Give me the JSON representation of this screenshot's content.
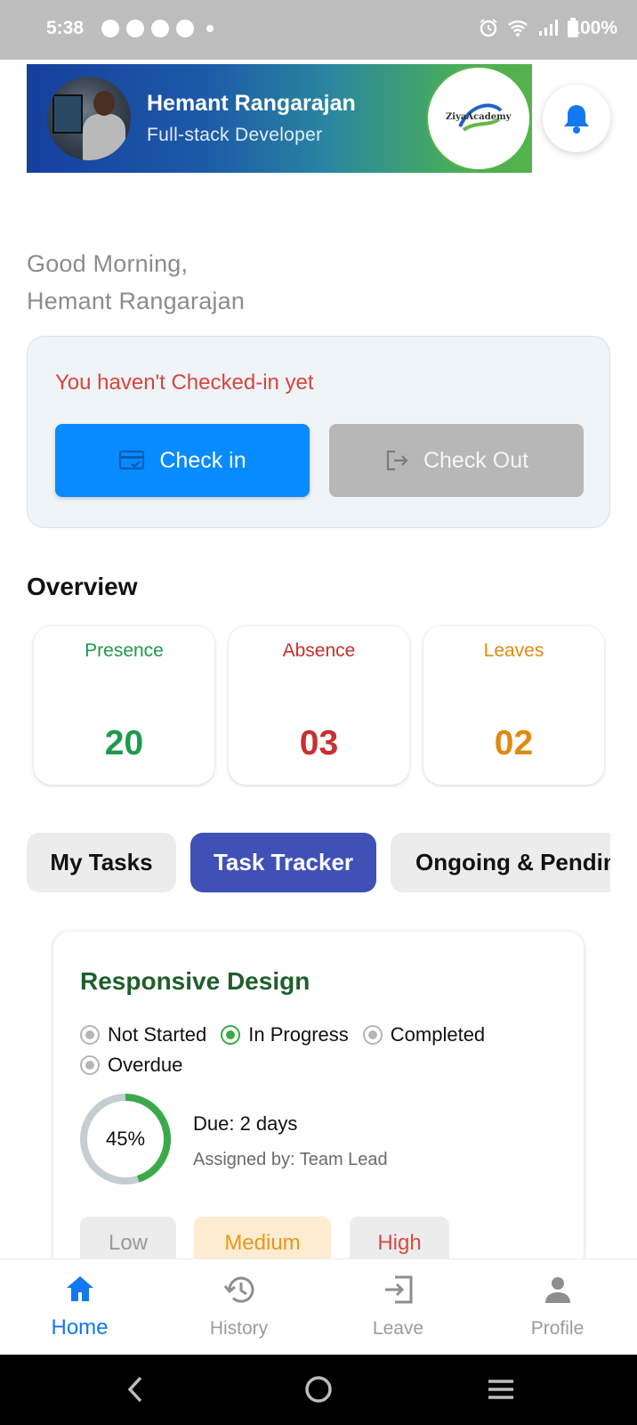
{
  "status_bar": {
    "time": "5:38",
    "battery": "100%",
    "notification_icons": [
      "chat-icon",
      "whatsapp-icon",
      "app-icon",
      "compass-icon",
      "dot-icon"
    ],
    "system_icons": [
      "alarm-icon",
      "wifi-icon",
      "signal-icon",
      "battery-icon"
    ]
  },
  "profile": {
    "name": "Hemant Rangarajan",
    "role": "Full-stack Developer",
    "logo_text": "ZiyaAcademy"
  },
  "greeting": {
    "line1": "Good Morning,",
    "line2": "Hemant Rangarajan"
  },
  "checkin": {
    "status_message": "You haven't Checked-in yet",
    "checkin_label": "Check in",
    "checkout_label": "Check Out"
  },
  "overview": {
    "title": "Overview",
    "stats": [
      {
        "label": "Presence",
        "value": "20",
        "color": "#1e9a4a"
      },
      {
        "label": "Absence",
        "value": "03",
        "color": "#c8302e"
      },
      {
        "label": "Leaves",
        "value": "02",
        "color": "#e08a12"
      }
    ]
  },
  "tabs": [
    {
      "label": "My Tasks",
      "active": false
    },
    {
      "label": "Task Tracker",
      "active": true
    },
    {
      "label": "Ongoing & Pending",
      "active": false
    }
  ],
  "task": {
    "title": "Responsive Design",
    "statuses": [
      {
        "label": "Not Started",
        "selected": false
      },
      {
        "label": "In Progress",
        "selected": true
      },
      {
        "label": "Completed",
        "selected": false
      },
      {
        "label": "Overdue",
        "selected": false
      }
    ],
    "progress": 0.45,
    "progress_label": "45%",
    "due": "Due: 2 days",
    "assigned_by": "Assigned by: Team Lead",
    "priorities": [
      "Low",
      "Medium",
      "High"
    ]
  },
  "bottom_nav": [
    {
      "label": "Home",
      "icon": "home-icon",
      "active": true
    },
    {
      "label": "History",
      "icon": "history-icon",
      "active": false
    },
    {
      "label": "Leave",
      "icon": "leave-icon",
      "active": false
    },
    {
      "label": "Profile",
      "icon": "person-icon",
      "active": false
    }
  ],
  "colors": {
    "primary_blue": "#078bff",
    "tab_active": "#3f51b5",
    "warning_red": "#d9443a",
    "progress_green": "#3aaa48",
    "task_title_green": "#1f5e2b"
  }
}
